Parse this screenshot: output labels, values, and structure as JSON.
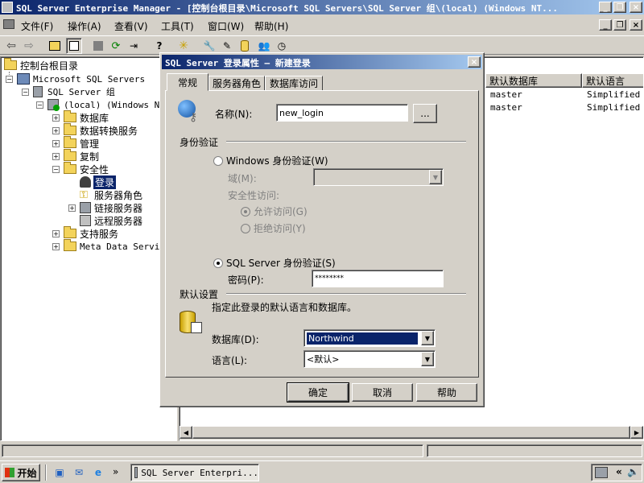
{
  "window": {
    "title": "SQL Server Enterprise Manager - [控制台根目录\\Microsoft SQL Servers\\SQL Server 组\\(local) (Windows NT..."
  },
  "menu": [
    "文件(F)",
    "操作(A)",
    "查看(V)",
    "工具(T)",
    "窗口(W)",
    "帮助(H)"
  ],
  "tree": {
    "header": "控制台根目录",
    "items": [
      {
        "label": "Microsoft SQL Servers"
      },
      {
        "label": "SQL Server 组"
      },
      {
        "label": "(local) (Windows NT)"
      },
      {
        "label": "数据库"
      },
      {
        "label": "数据转换服务"
      },
      {
        "label": "管理"
      },
      {
        "label": "复制"
      },
      {
        "label": "安全性"
      },
      {
        "label": "登录"
      },
      {
        "label": "服务器角色"
      },
      {
        "label": "链接服务器"
      },
      {
        "label": "远程服务器"
      },
      {
        "label": "支持服务"
      },
      {
        "label": "Meta Data Service"
      }
    ]
  },
  "list": {
    "columns": [
      "默认数据库",
      "默认语言"
    ],
    "rows": [
      [
        "master",
        "Simplified C"
      ],
      [
        "master",
        "Simplified C"
      ]
    ]
  },
  "dialog": {
    "title": "SQL Server 登录属性 — 新建登录",
    "tabs": [
      "常规",
      "服务器角色",
      "数据库访问"
    ],
    "name_label": "名称(N):",
    "name_value": "new_login",
    "browse_label": "...",
    "auth_group": "身份验证",
    "win_auth_label": "Windows 身份验证(W)",
    "domain_label": "域(M):",
    "security_access_label": "安全性访问:",
    "grant_label": "允许访问(G)",
    "deny_label": "拒绝访问(Y)",
    "sql_auth_label": "SQL Server 身份验证(S)",
    "password_label": "密码(P):",
    "password_value": "********",
    "defaults_group": "默认设置",
    "defaults_desc": "指定此登录的默认语言和数据库。",
    "database_label": "数据库(D):",
    "database_value": "Northwind",
    "language_label": "语言(L):",
    "language_value": "<默认>",
    "ok": "确定",
    "cancel": "取消",
    "help": "帮助",
    "close": "×"
  },
  "taskbar": {
    "start": "开始",
    "task": "SQL Server Enterpri...",
    "more": "»"
  },
  "colors": {
    "titlebar": "#0a246a",
    "selection": "#0a246a",
    "desktop": "#d4d0c8"
  }
}
